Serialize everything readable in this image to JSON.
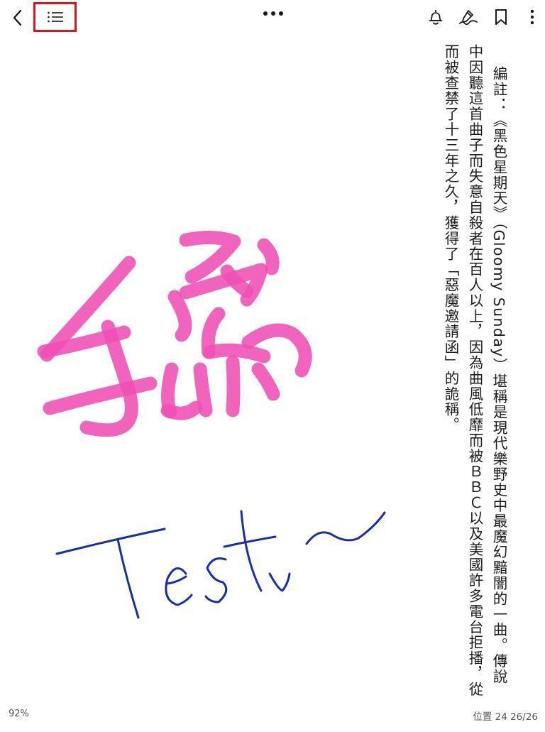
{
  "toolbar": {
    "back_icon": "chevron-left-icon",
    "toc_icon": "list-icon",
    "more_icon": "horizontal-dots-icon",
    "tts_icon": "bell-speaker-icon",
    "draw_icon": "pen-scribble-icon",
    "bookmark_icon": "bookmark-icon",
    "menu_icon": "vertical-dots-icon",
    "highlight_color": "#e0141e"
  },
  "content": {
    "paragraph1": "編註：《黑色星期天》（Gloomy Sunday）堪稱是現代樂野史中最魔幻黯闇的一曲。傳說中因聽這首曲子而失意自殺者在百人以上，因為曲風低靡而被ＢＢＣ以及美國許多電台拒播，從而被查禁了十三年之久，獲得了「惡魔邀請函」的詭稱。"
  },
  "annotations": {
    "handwriting_pink": "手寫",
    "handwriting_blue": "Test~",
    "pink_color": "#ee4fb4",
    "blue_color": "#1a2ea6"
  },
  "footer": {
    "zoom": "92%",
    "position": "位置 24 26/26"
  }
}
